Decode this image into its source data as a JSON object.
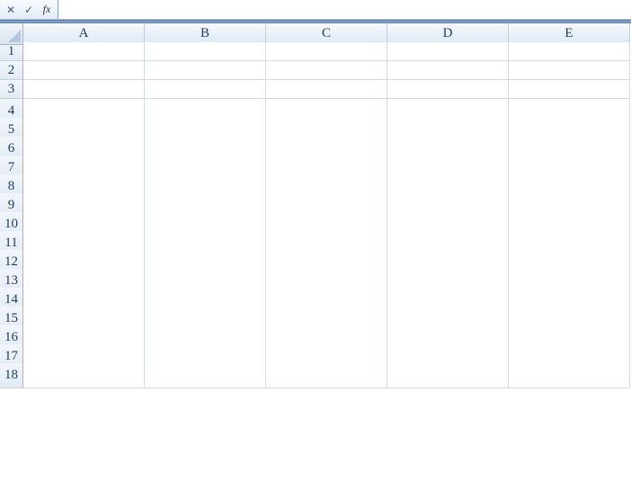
{
  "formula_bar": {
    "cancel_symbol": "✕",
    "confirm_symbol": "✓",
    "fx_label": "fx",
    "input_value": ""
  },
  "columns": [
    "A",
    "B",
    "C",
    "D",
    "E"
  ],
  "rows": [
    "1",
    "2",
    "3",
    "4",
    "5",
    "6",
    "7",
    "8",
    "9",
    "10",
    "11",
    "12",
    "13",
    "14",
    "15",
    "16",
    "17",
    "18"
  ],
  "cells": {}
}
